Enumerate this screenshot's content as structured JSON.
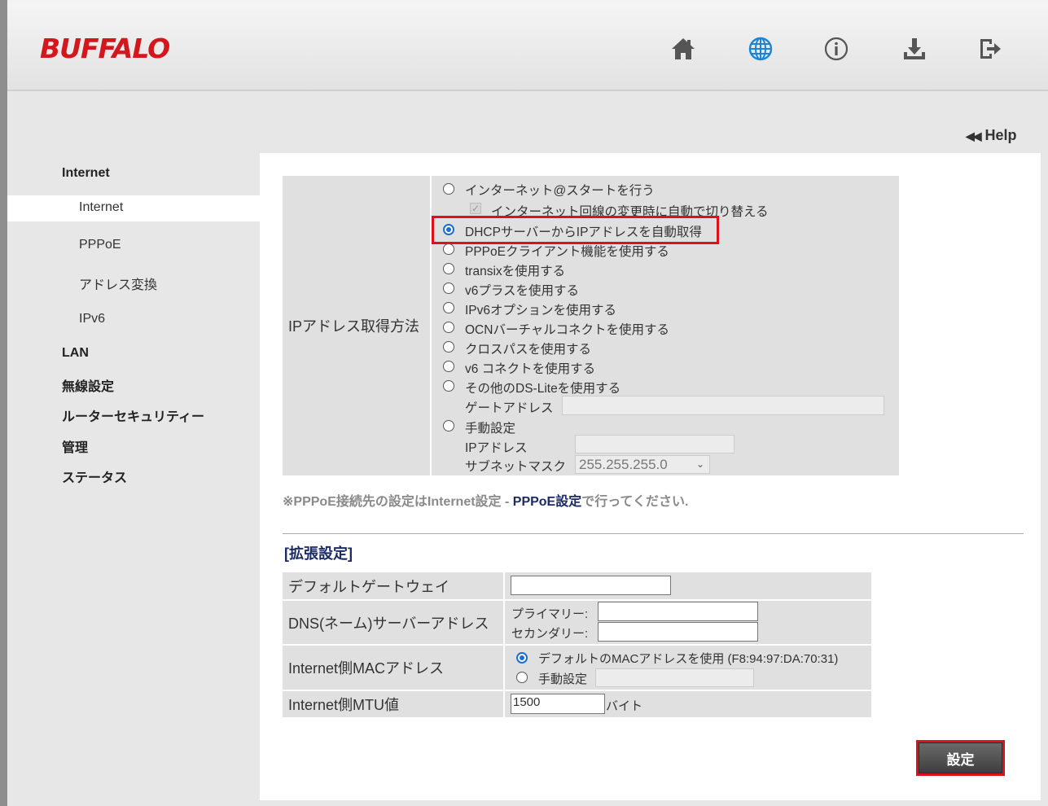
{
  "brand": {
    "logo": "BUFFALO",
    "accent": "#d4161d"
  },
  "header": {
    "icons": [
      "home-icon",
      "globe-icon",
      "info-icon",
      "download-icon",
      "logout-icon"
    ],
    "active_icon_color": "#1a84d9"
  },
  "help": {
    "label": "Help",
    "arrows": "◀◀"
  },
  "sidebar": {
    "internet": "Internet",
    "items": [
      "Internet",
      "PPPoE",
      "アドレス変換",
      "IPv6"
    ],
    "lan": "LAN",
    "wireless": "無線設定",
    "security": "ルーターセキュリティー",
    "admin": "管理",
    "status": "ステータス"
  },
  "ip_method": {
    "label": "IPアドレス取得方法",
    "options": [
      "インターネット@スタートを行う",
      "インターネット回線の変更時に自動で切り替える",
      "DHCPサーバーからIPアドレスを自動取得",
      "PPPoEクライアント機能を使用する",
      "transixを使用する",
      "v6プラスを使用する",
      "IPv6オプションを使用する",
      "OCNバーチャルコネクトを使用する",
      "クロスパスを使用する",
      "v6 コネクトを使用する",
      "その他のDS-Liteを使用する",
      "手動設定"
    ],
    "selected_index": 2,
    "gateway_label": "ゲートアドレス",
    "ip_label": "IPアドレス",
    "subnet_label": "サブネットマスク",
    "subnet_value": "255.255.255.0"
  },
  "note": {
    "prefix": "※PPPoE接続先の設定はInternet設定 - ",
    "link": "PPPoE設定",
    "suffix": "で行ってください."
  },
  "extended": {
    "title": "[拡張設定]",
    "gateway_label": "デフォルトゲートウェイ",
    "gateway_value": "",
    "dns_label": "DNS(ネーム)サーバーアドレス",
    "dns_primary_label": "プライマリー:",
    "dns_secondary_label": "セカンダリー:",
    "mac_label": "Internet側MACアドレス",
    "mac_default": "デフォルトのMACアドレスを使用 (F8:94:97:DA:70:31)",
    "mac_manual": "手動設定",
    "mtu_label": "Internet側MTU値",
    "mtu_value": "1500",
    "mtu_unit": "バイト"
  },
  "submit": {
    "label": "設定"
  }
}
